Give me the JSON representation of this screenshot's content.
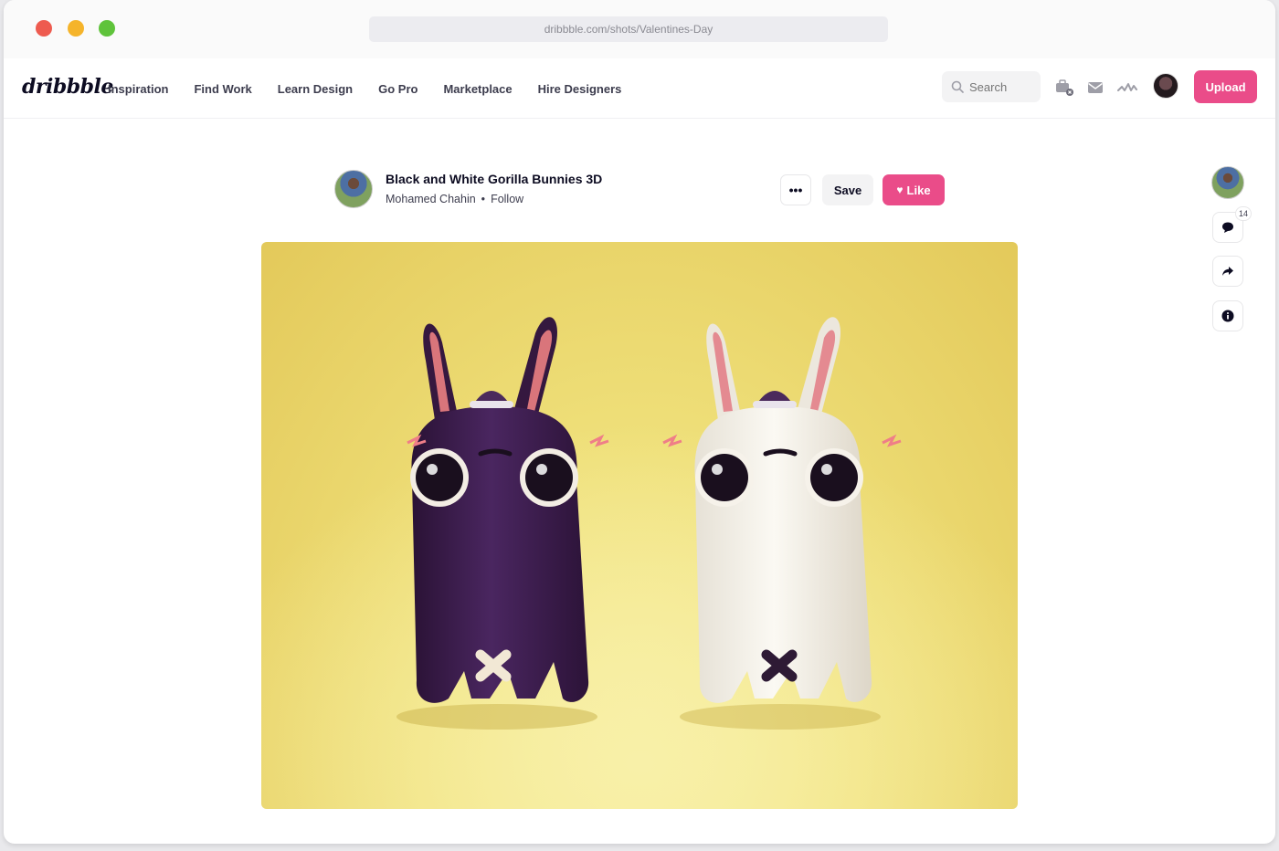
{
  "browser": {
    "url": "dribbble.com/shots/Valentines-Day"
  },
  "nav": {
    "logo": "dribbble",
    "links": [
      "Inspiration",
      "Find Work",
      "Learn Design",
      "Go Pro",
      "Marketplace",
      "Hire Designers"
    ],
    "search_placeholder": "Search",
    "upload_label": "Upload"
  },
  "shot": {
    "title": "Black and White Gorilla Bunnies 3D",
    "author": "Mohamed Chahin",
    "follow_label": "Follow",
    "more_label": "•••",
    "save_label": "Save",
    "like_label": "Like"
  },
  "sidebar": {
    "comment_count": "14"
  },
  "colors": {
    "accent": "#ea4c89",
    "image_background": "#ecdc6e",
    "bunny_dark": "#3c1f4c",
    "bunny_light": "#f4f1ea"
  }
}
